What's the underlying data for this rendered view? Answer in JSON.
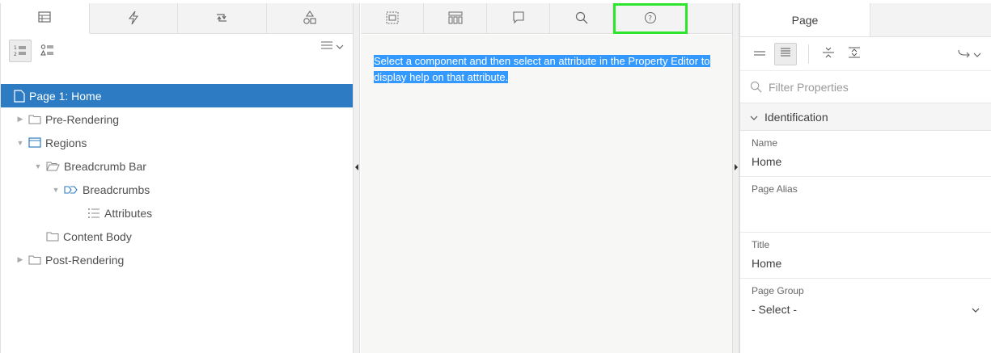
{
  "left_tabs": [
    "rendering-tab",
    "dynamic-actions-tab",
    "processing-tab",
    "shared-components-tab"
  ],
  "tree": {
    "nodes": [
      {
        "label": "Page 1: Home"
      },
      {
        "label": "Pre-Rendering"
      },
      {
        "label": "Regions"
      },
      {
        "label": "Breadcrumb Bar"
      },
      {
        "label": "Breadcrumbs"
      },
      {
        "label": "Attributes"
      },
      {
        "label": "Content Body"
      },
      {
        "label": "Post-Rendering"
      }
    ]
  },
  "middle_tabs": [
    "layout-tab",
    "page-search-tab",
    "comments-tab",
    "search-tab",
    "help-tab"
  ],
  "help_text": "Select a component and then select an attribute in the Property Editor to display help on that attribute.",
  "right": {
    "tab_label": "Page",
    "filter_placeholder": "Filter Properties",
    "group_label": "Identification",
    "properties": [
      {
        "label": "Name",
        "value": "Home"
      },
      {
        "label": "Page Alias",
        "value": ""
      },
      {
        "label": "Title",
        "value": "Home"
      },
      {
        "label": "Page Group",
        "value": "- Select -"
      }
    ]
  },
  "colors": {
    "selection": "#2d7cc3",
    "highlight_outline": "#2ee52e",
    "text_selection": "#3399ff"
  }
}
